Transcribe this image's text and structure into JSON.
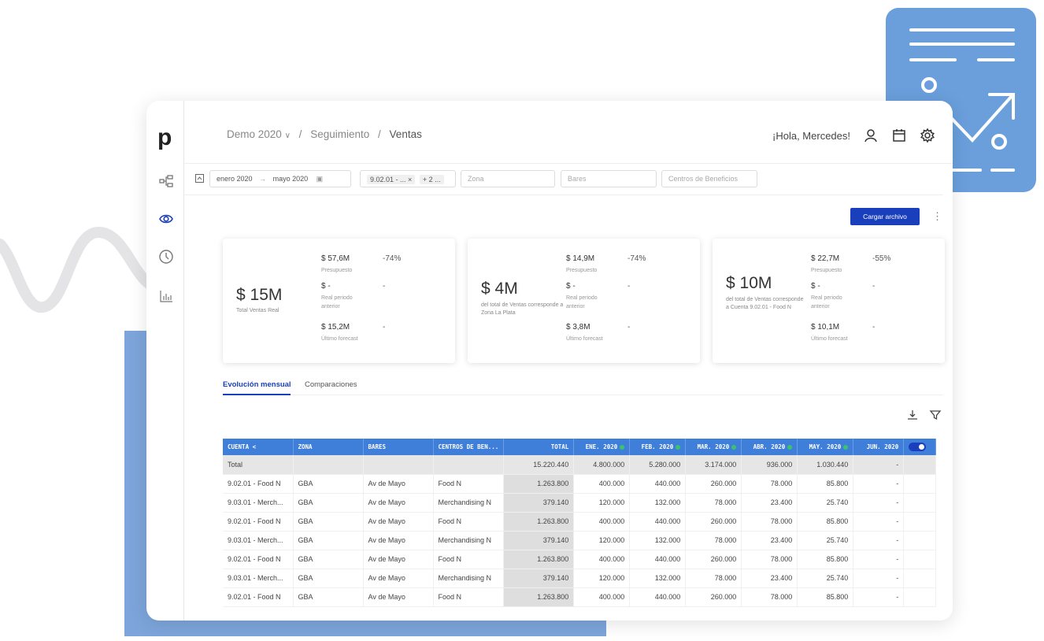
{
  "breadcrumb": {
    "project": "Demo 2020",
    "section": "Seguimiento",
    "page": "Ventas"
  },
  "header": {
    "greeting": "¡Hola, Mercedes!"
  },
  "filters": {
    "date_from": "enero 2020",
    "date_to": "mayo 2020",
    "account_tag": "9.02.01 - ...",
    "account_more": "+ 2 ...",
    "zona_placeholder": "Zona",
    "bares_placeholder": "Bares",
    "centros_placeholder": "Centros de Beneficios"
  },
  "actions": {
    "upload_label": "Cargar archivo"
  },
  "cards": [
    {
      "big_value": "$ 15M",
      "caption": "Total Ventas Real",
      "metrics": [
        {
          "value": "$ 57,6M",
          "pct": "-74%",
          "label": "Presupuesto"
        },
        {
          "value": "$ -",
          "pct": "-",
          "label": "Real periodo anterior"
        },
        {
          "value": "$ 15,2M",
          "pct": "-",
          "label": "Último forecast"
        }
      ]
    },
    {
      "big_value": "$ 4M",
      "caption": "del total de Ventas corresponde a Zona La Plata",
      "metrics": [
        {
          "value": "$ 14,9M",
          "pct": "-74%",
          "label": "Presupuesto"
        },
        {
          "value": "$ -",
          "pct": "-",
          "label": "Real periodo anterior"
        },
        {
          "value": "$ 3,8M",
          "pct": "-",
          "label": "Último forecast"
        }
      ]
    },
    {
      "big_value": "$ 10M",
      "caption": "del total de Ventas corresponde a Cuenta 9.02.01 - Food N",
      "metrics": [
        {
          "value": "$ 22,7M",
          "pct": "-55%",
          "label": "Presupuesto"
        },
        {
          "value": "$ -",
          "pct": "-",
          "label": "Real periodo anterior"
        },
        {
          "value": "$ 10,1M",
          "pct": "-",
          "label": "Último forecast"
        }
      ]
    }
  ],
  "tabs": [
    {
      "label": "Evolución mensual",
      "active": true
    },
    {
      "label": "Comparaciones",
      "active": false
    }
  ],
  "table": {
    "headers": [
      "CUENTA <",
      "ZONA",
      "BARES",
      "CENTROS DE BEN...",
      "TOTAL",
      "ENE. 2020",
      "FEB. 2020",
      "MAR. 2020",
      "ABR. 2020",
      "MAY. 2020",
      "JUN. 2020"
    ],
    "total_row": [
      "Total",
      "",
      "",
      "",
      "15.220.440",
      "4.800.000",
      "5.280.000",
      "3.174.000",
      "936.000",
      "1.030.440",
      "-"
    ],
    "rows": [
      [
        "9.02.01 - Food N",
        "GBA",
        "Av de Mayo",
        "Food N",
        "1.263.800",
        "400.000",
        "440.000",
        "260.000",
        "78.000",
        "85.800",
        "-"
      ],
      [
        "9.03.01 - Merch...",
        "GBA",
        "Av de Mayo",
        "Merchandising N",
        "379.140",
        "120.000",
        "132.000",
        "78.000",
        "23.400",
        "25.740",
        "-"
      ],
      [
        "9.02.01 - Food N",
        "GBA",
        "Av de Mayo",
        "Food N",
        "1.263.800",
        "400.000",
        "440.000",
        "260.000",
        "78.000",
        "85.800",
        "-"
      ],
      [
        "9.03.01 - Merch...",
        "GBA",
        "Av de Mayo",
        "Merchandising N",
        "379.140",
        "120.000",
        "132.000",
        "78.000",
        "23.400",
        "25.740",
        "-"
      ],
      [
        "9.02.01 - Food N",
        "GBA",
        "Av de Mayo",
        "Food N",
        "1.263.800",
        "400.000",
        "440.000",
        "260.000",
        "78.000",
        "85.800",
        "-"
      ],
      [
        "9.03.01 - Merch...",
        "GBA",
        "Av de Mayo",
        "Merchandising N",
        "379.140",
        "120.000",
        "132.000",
        "78.000",
        "23.400",
        "25.740",
        "-"
      ],
      [
        "9.02.01 - Food N",
        "GBA",
        "Av de Mayo",
        "Food N",
        "1.263.800",
        "400.000",
        "440.000",
        "260.000",
        "78.000",
        "85.800",
        "-"
      ]
    ]
  },
  "colors": {
    "accent": "#1a3fbd",
    "table_header": "#3f7fd9",
    "status_green": "#3cc26a",
    "badge_bg": "#6a9fdc"
  }
}
